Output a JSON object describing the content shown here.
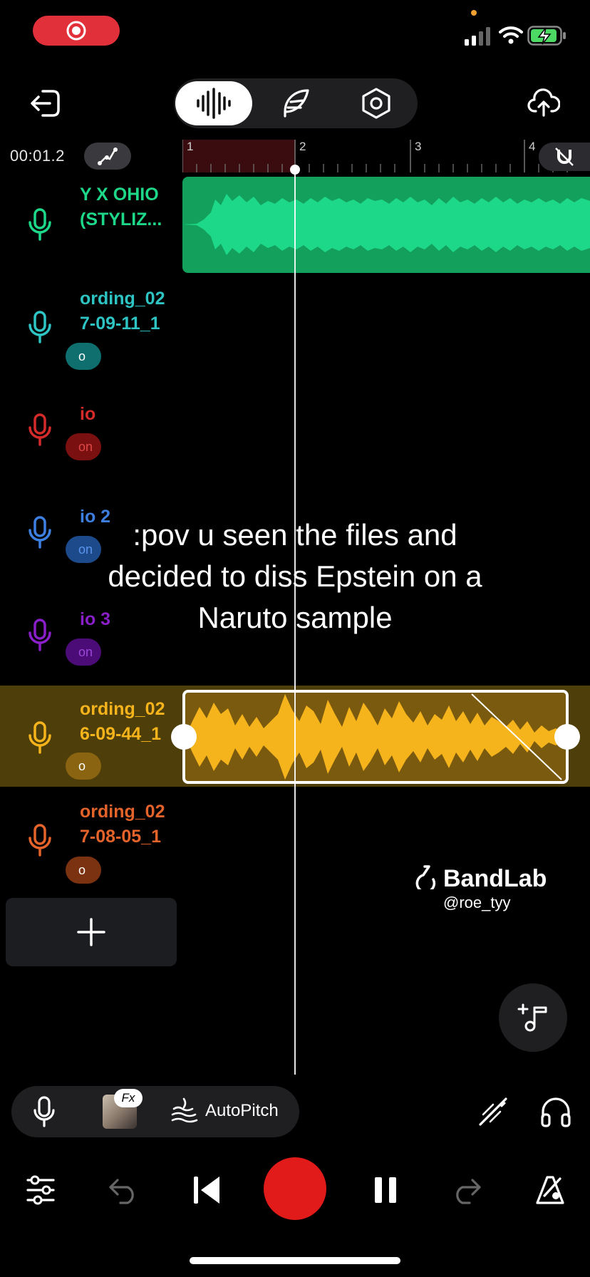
{
  "status_bar": {
    "recording_icon": "record-icon",
    "signal_icon": "signal-icon",
    "wifi_icon": "wifi-icon",
    "battery_icon": "battery-charging-icon"
  },
  "toolbar": {
    "exit_icon": "exit-icon",
    "tabs": [
      {
        "name": "waveform-tab",
        "icon": "waveform-icon",
        "active": true
      },
      {
        "name": "feather-tab",
        "icon": "feather-icon",
        "active": false
      },
      {
        "name": "settings-tab",
        "icon": "hexagon-settings-icon",
        "active": false
      }
    ],
    "upload_icon": "cloud-upload-icon"
  },
  "timeline": {
    "time": "00:01.2",
    "ruler_marks": [
      "1",
      "2",
      "3",
      "4"
    ],
    "automation_icon": "automation-icon",
    "snap_icon": "magnet-off-icon"
  },
  "tracks": [
    {
      "name_line1": "Y X OHIO",
      "name_line2": "(STYLIZ...",
      "pill": "",
      "color": "#1ed88a"
    },
    {
      "name_line1": "ording_02",
      "name_line2": "7-09-11_1",
      "pill": "o",
      "color": "#2ec4c4"
    },
    {
      "name_line1": "io",
      "name_line2": "",
      "pill": "on",
      "color": "#d42a2a"
    },
    {
      "name_line1": "io 2",
      "name_line2": "",
      "pill": "on",
      "color": "#3d7fe0"
    },
    {
      "name_line1": "io 3",
      "name_line2": "",
      "pill": "on",
      "color": "#8a1ec8"
    },
    {
      "name_line1": "ording_02",
      "name_line2": "6-09-44_1",
      "pill": "o",
      "color": "#f5b31c"
    },
    {
      "name_line1": "ording_02",
      "name_line2": "7-08-05_1",
      "pill": "o",
      "color": "#e4632a"
    }
  ],
  "caption": {
    "line1": ":pov u seen the files and",
    "line2": "decided to diss Epstein on a",
    "line3": "Naruto sample"
  },
  "watermark": {
    "brand": "BandLab",
    "user": "@roe_tyy"
  },
  "tools": {
    "fx_label": "Fx",
    "autopitch_label": "AutoPitch"
  },
  "colors": {
    "accent_red": "#e11a1a",
    "green_clip": "#1ed88a",
    "yellow_clip": "#f5b31c",
    "background": "#000000"
  }
}
